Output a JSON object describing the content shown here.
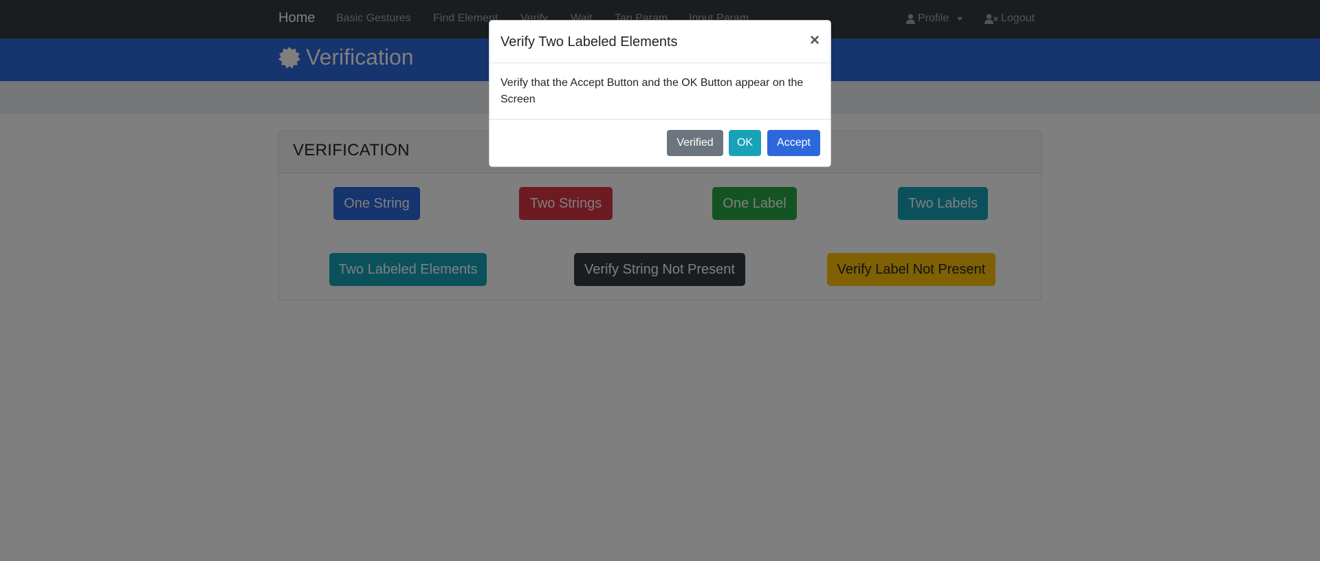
{
  "navbar": {
    "brand": "Home",
    "links": [
      "Basic Gestures",
      "Find Element",
      "Verify",
      "Wait",
      "Tap Param",
      "Input Param"
    ],
    "profile": "Profile",
    "logout": "Logout"
  },
  "header": {
    "title": "Verification"
  },
  "card": {
    "title": "VERIFICATION",
    "buttons": [
      "One String",
      "Two Strings",
      "One Label",
      "Two Labels",
      "Two Labeled Elements",
      "Verify String Not Present",
      "Verify Label Not Present"
    ]
  },
  "modal": {
    "title": "Verify Two Labeled Elements",
    "close": "×",
    "body": "Verify that the Accept Button and the OK Button appear on the Screen",
    "buttons": {
      "verified": "Verified",
      "ok": "OK",
      "accept": "Accept"
    }
  },
  "colors": {
    "navbar": "#343a40",
    "primary": "#2d68db",
    "danger": "#dc3545",
    "success": "#28a745",
    "info": "#17a2b8",
    "secondary": "#6c757d",
    "dark": "#343a40",
    "warning": "#ffc107"
  }
}
